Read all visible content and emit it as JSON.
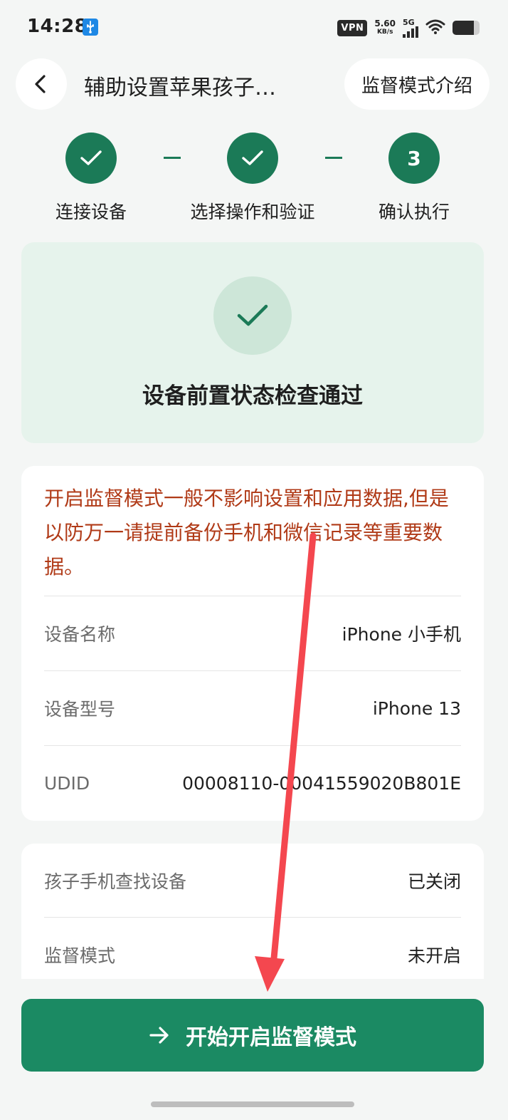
{
  "status_bar": {
    "time": "14:28",
    "vpn": "VPN",
    "speed_value": "5.60",
    "speed_unit": "KB/s",
    "network": "5G",
    "battery_level": 0.8
  },
  "header": {
    "title": "辅助设置苹果孩子…",
    "intro_button": "监督模式介绍"
  },
  "steps": [
    {
      "label": "连接设备",
      "state": "done"
    },
    {
      "label": "选择操作和验证",
      "state": "done"
    },
    {
      "label": "确认执行",
      "state": "current",
      "number": "3"
    }
  ],
  "success": {
    "text": "设备前置状态检查通过"
  },
  "warning": "开启监督模式一般不影响设置和应用数据,但是以防万一请提前备份手机和微信记录等重要数据。",
  "device_info": [
    {
      "label": "设备名称",
      "value": "iPhone 小手机"
    },
    {
      "label": "设备型号",
      "value": "iPhone 13"
    },
    {
      "label": "UDID",
      "value": "00008110-00041559020B801E"
    }
  ],
  "status_rows": [
    {
      "label": "孩子手机查找设备",
      "value": "已关闭"
    },
    {
      "label": "监督模式",
      "value": "未开启"
    }
  ],
  "cta": {
    "label": "开始开启监督模式"
  },
  "colors": {
    "primary": "#1b8a63",
    "step": "#1b7a57",
    "warning": "#b03a17",
    "success_bg": "#e6f3ec",
    "annotation": "#f4474f"
  }
}
